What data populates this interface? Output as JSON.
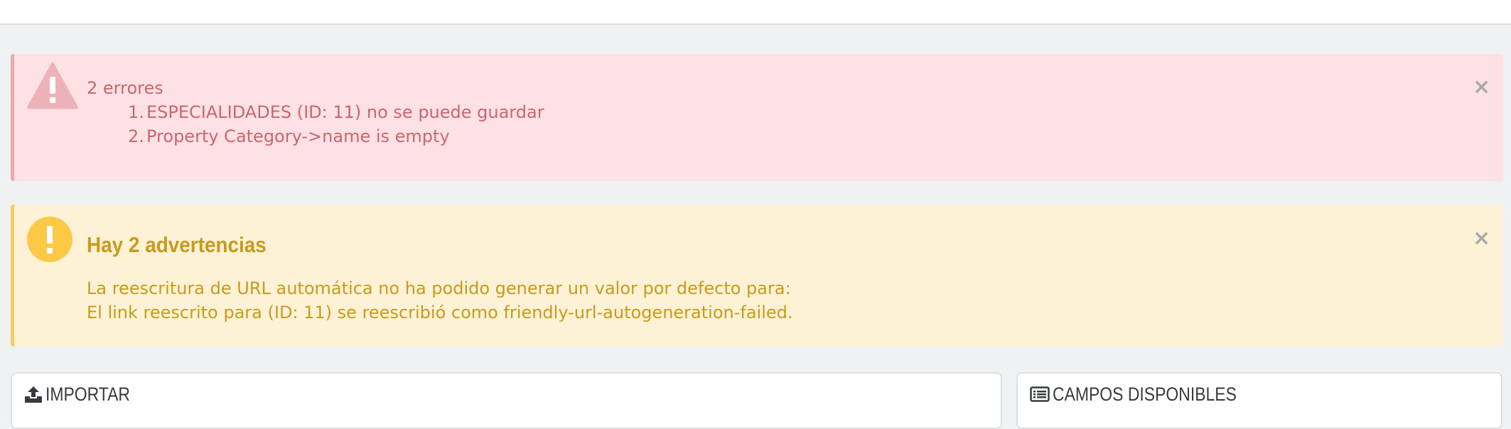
{
  "errors_alert": {
    "heading": "2 errores",
    "items": [
      {
        "number": "1.",
        "text": "ESPECIALIDADES (ID: 11) no se puede guardar"
      },
      {
        "number": "2.",
        "text": "Property Category->name is empty"
      }
    ],
    "close_symbol": "×",
    "icon": "warning-triangle-icon",
    "background_color": "#fde1e4",
    "text_color": "#c9666f"
  },
  "warning_alert": {
    "title": "Hay 2 advertencias",
    "lines": [
      "La reescritura de URL automática no ha podido generar un valor por defecto para:",
      "El link reescrito para (ID: 11) se reescribió como friendly-url-autogeneration-failed."
    ],
    "close_symbol": "×",
    "icon": "exclamation-circle-icon",
    "background_color": "#fdf1d6",
    "text_color": "#c89b1d"
  },
  "panels": {
    "import": {
      "title": "IMPORTAR",
      "icon": "upload-icon"
    },
    "available_fields": {
      "title": "CAMPOS DISPONIBLES",
      "icon": "list-icon"
    }
  }
}
